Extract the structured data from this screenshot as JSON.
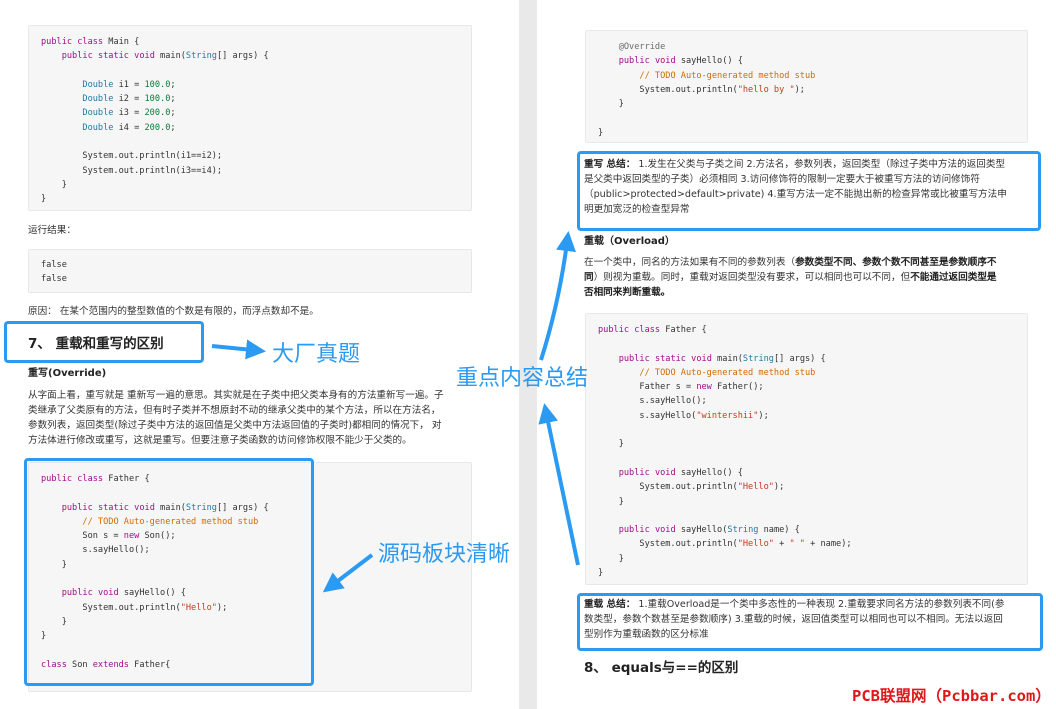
{
  "left": {
    "code1": [
      [
        "public class Main {"
      ],
      [
        "    public static void main(String[] args) {"
      ],
      [
        ""
      ],
      [
        "        Double i1 = 100.0;"
      ],
      [
        "        Double i2 = 100.0;"
      ],
      [
        "        Double i3 = 200.0;"
      ],
      [
        "        Double i4 = 200.0;"
      ],
      [
        ""
      ],
      [
        "        System.out.println(i1==i2);"
      ],
      [
        "        System.out.println(i3==i4);"
      ],
      [
        "    }"
      ],
      [
        "}"
      ]
    ],
    "run_label": "运行结果：",
    "output": [
      "false",
      "false"
    ],
    "reason": "原因： 在某个范围内的整型数值的个数是有限的，而浮点数却不是。",
    "heading": "7、 重载和重写的区别",
    "override_title": "重写(Override)",
    "override_para": [
      "从字面上看，重写就是 重新写一遍的意思。其实就是在子类中把父类本身有的方法重新写一遍。子",
      "类继承了父类原有的方法，但有时子类并不想原封不动的继承父类中的某个方法，所以在方法名，",
      "参数列表，返回类型(除过子类中方法的返回值是父类中方法返回值的子类时)都相同的情况下， 对",
      "方法体进行修改或重写，这就是重写。但要注意子类函数的访问修饰权限不能少于父类的。"
    ],
    "code2": [
      "public class Father {",
      "",
      "    public static void main(String[] args) {",
      "        // TODO Auto-generated method stub",
      "        Son s = new Son();",
      "        s.sayHello();",
      "    }",
      "",
      "    public void sayHello() {",
      "        System.out.println(\"Hello\");",
      "    }",
      "}",
      "",
      "class Son extends Father{"
    ]
  },
  "right": {
    "code3": [
      "    @Override",
      "    public void sayHello() {",
      "        // TODO Auto-generated method stub",
      "        System.out.println(\"hello by \");",
      "    }",
      "",
      "}"
    ],
    "override_summary": {
      "label": "重写 总结：",
      "lines": [
        " 1.发生在父类与子类之间 2.方法名，参数列表，返回类型（除过子类中方法的返回类型",
        "是父类中返回类型的子类）必须相同 3.访问修饰符的限制一定要大于被重写方法的访问修饰符",
        "（public>protected>default>private) 4.重写方法一定不能抛出新的检查异常或比被重写方法申",
        "明更加宽泛的检查型异常"
      ]
    },
    "overload_title": "重载（Overload）",
    "overload_para": {
      "p1": "在一个类中，同名的方法如果有不同的参数列表（",
      "p1b": "参数类型不同、参数个数不同甚至是参数顺序不",
      "p2b": "同",
      "p2": "）则视为重载。同时，重载对返回类型没有要求，可以相同也可以不同，但",
      "p2c": "不能通过返回类型是",
      "p3b": "否相同来判断重载。"
    },
    "code4": [
      "public class Father {",
      "",
      "    public static void main(String[] args) {",
      "        // TODO Auto-generated method stub",
      "        Father s = new Father();",
      "        s.sayHello();",
      "        s.sayHello(\"wintershii\");",
      "",
      "    }",
      "",
      "    public void sayHello() {",
      "        System.out.println(\"Hello\");",
      "    }",
      "",
      "    public void sayHello(String name) {",
      "        System.out.println(\"Hello\" + \" \" + name);",
      "    }",
      "}"
    ],
    "overload_summary": {
      "label": "重载 总结：",
      "lines": [
        " 1.重载Overload是一个类中多态性的一种表现 2.重载要求同名方法的参数列表不同(参",
        "数类型，参数个数甚至是参数顺序) 3.重载的时候，返回值类型可以相同也可以不相同。无法以返回",
        "型别作为重载函数的区分标准"
      ]
    },
    "heading": "8、 equals与==的区别"
  },
  "annotations": {
    "interview": "大厂真题",
    "summary": "重点内容总结",
    "source": "源码板块清晰"
  },
  "watermark": "PCB联盟网（Pcbbar.com）",
  "colors": {
    "highlight": "#2b9af3",
    "watermark": "#e0181b"
  }
}
